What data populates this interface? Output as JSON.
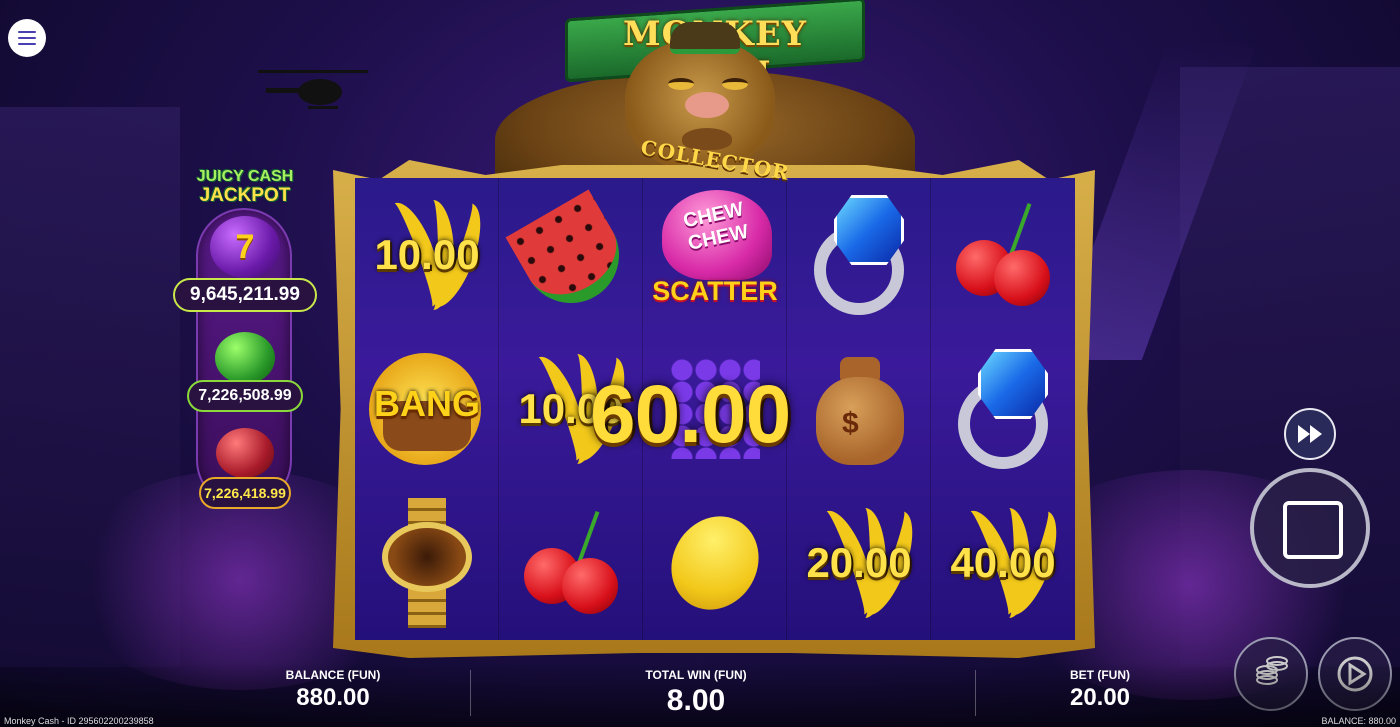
{
  "game": {
    "logo": "MONKEY CA$H",
    "collector": "COLLECTOR"
  },
  "jackpot": {
    "title_line1": "JUICY CASH",
    "title_line2": "JACKPOT",
    "seven_symbol": "7",
    "levels": [
      {
        "icon": "seven-icon",
        "value": "9,645,211.99"
      },
      {
        "icon": "watermelon-icon",
        "value": "7,226,508.99"
      },
      {
        "icon": "cherry-icon",
        "value": "7,226,418.99"
      }
    ]
  },
  "reels": {
    "r1": {
      "top_cash": "10.00",
      "mid": "BANG"
    },
    "r2": {
      "mid_cash": "10.00"
    },
    "r3": {
      "scatter_top": "CHEW CHEW",
      "scatter_label": "SCATTER"
    },
    "r4": {
      "bottom_cash": "20.00",
      "bag_symbol": "$"
    },
    "r5": {
      "bottom_cash": "40.00"
    },
    "big_win": "60.00"
  },
  "bottom": {
    "balance_label": "BALANCE (FUN)",
    "balance_value": "880.00",
    "win_label": "TOTAL WIN (FUN)",
    "win_value": "8.00",
    "bet_label": "BET (FUN)",
    "bet_value": "20.00",
    "footer_left": "Monkey Cash - ID 295602200239858",
    "footer_right": "BALANCE: 880.00"
  },
  "colors": {
    "accent_gold": "#ffdc3a",
    "frame_gold": "#d8b04a",
    "reel_bg": "#2a1a8a"
  }
}
